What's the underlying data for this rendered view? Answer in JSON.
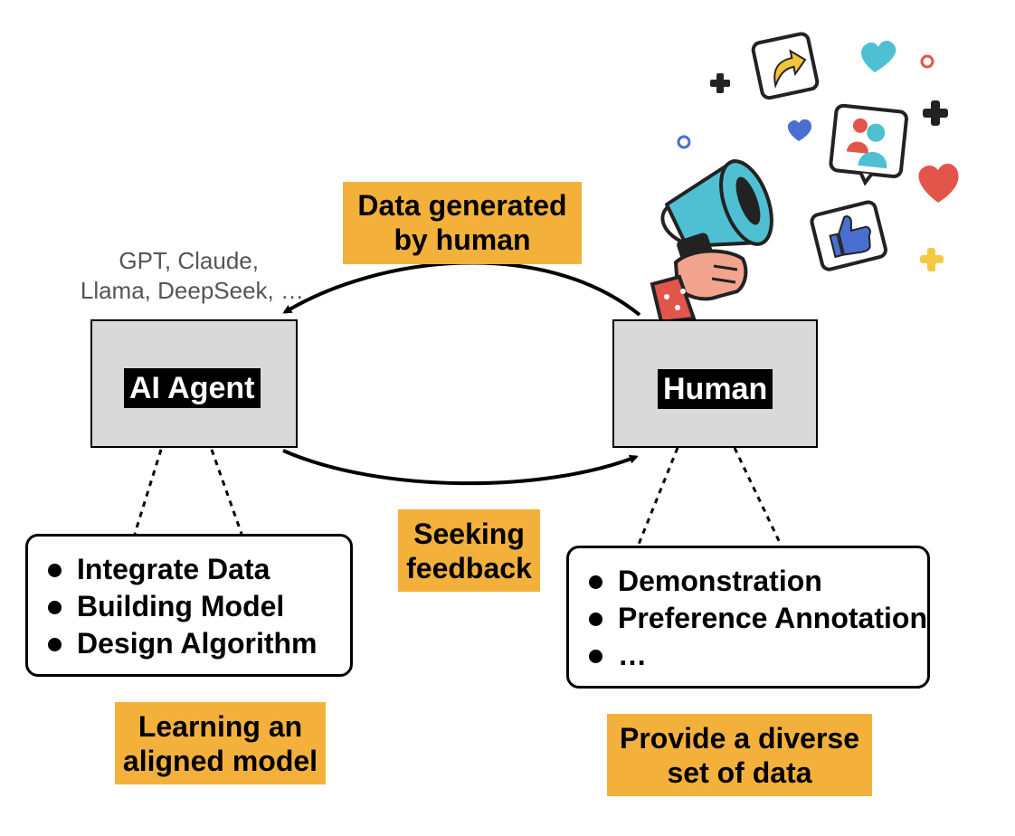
{
  "diagram": {
    "models_caption": {
      "line1": "GPT, Claude,",
      "line2": "Llama, DeepSeek, …"
    },
    "ai_agent": {
      "label": "AI Agent",
      "tasks": [
        "Integrate Data",
        "Building Model",
        "Design Algorithm"
      ],
      "goal": {
        "line1": "Learning an",
        "line2": "aligned model"
      }
    },
    "human": {
      "label": "Human",
      "tasks": [
        "Demonstration",
        "Preference Annotation",
        "…"
      ],
      "goal": {
        "line1": "Provide a diverse",
        "line2": "set of data"
      }
    },
    "arrow_top": {
      "line1": "Data generated",
      "line2": "by human"
    },
    "arrow_bottom": {
      "line1": "Seeking",
      "line2": "feedback"
    },
    "colors": {
      "box_fill": "#d9d9d9",
      "label_fill": "#000000",
      "highlight": "#f3b13c",
      "megaphone": "#4ec0d1"
    },
    "illustration": {
      "main": "megaphone-in-hand",
      "icons": [
        "share-icon",
        "heart-icon",
        "people-icon",
        "thumbs-up-icon",
        "plus-icon",
        "ring-icon"
      ]
    }
  }
}
